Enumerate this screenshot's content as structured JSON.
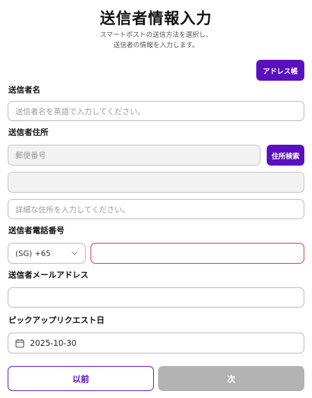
{
  "header": {
    "title": "送信者情報入力",
    "subtitle_line1": "スマートポストの送信方法を選択し、",
    "subtitle_line2": "送信者の情報を入力します。"
  },
  "address_book_button": "アドレス帳",
  "sender_name": {
    "label": "送信者名",
    "placeholder": "送信者名を英語で入力してください。",
    "value": ""
  },
  "sender_address": {
    "label": "送信者住所",
    "postal_placeholder": "郵便番号",
    "search_button": "住所検索",
    "address_value": "",
    "detail_placeholder": "詳細な住所を入力してください。"
  },
  "sender_phone": {
    "label": "送信者電話番号",
    "country_code": "(SG) +65",
    "number_value": ""
  },
  "sender_email": {
    "label": "送信者メールアドレス",
    "value": ""
  },
  "pickup": {
    "label": "ピックアップリクエスト日",
    "date": "2025-10-30"
  },
  "footer": {
    "prev_label": "以前",
    "next_label": "次"
  },
  "colors": {
    "accent": "#5b0fbe",
    "error_border": "#d9304a",
    "disabled_button": "#b3b3b3"
  },
  "icons": [
    "chevron-down-icon",
    "calendar-icon"
  ]
}
